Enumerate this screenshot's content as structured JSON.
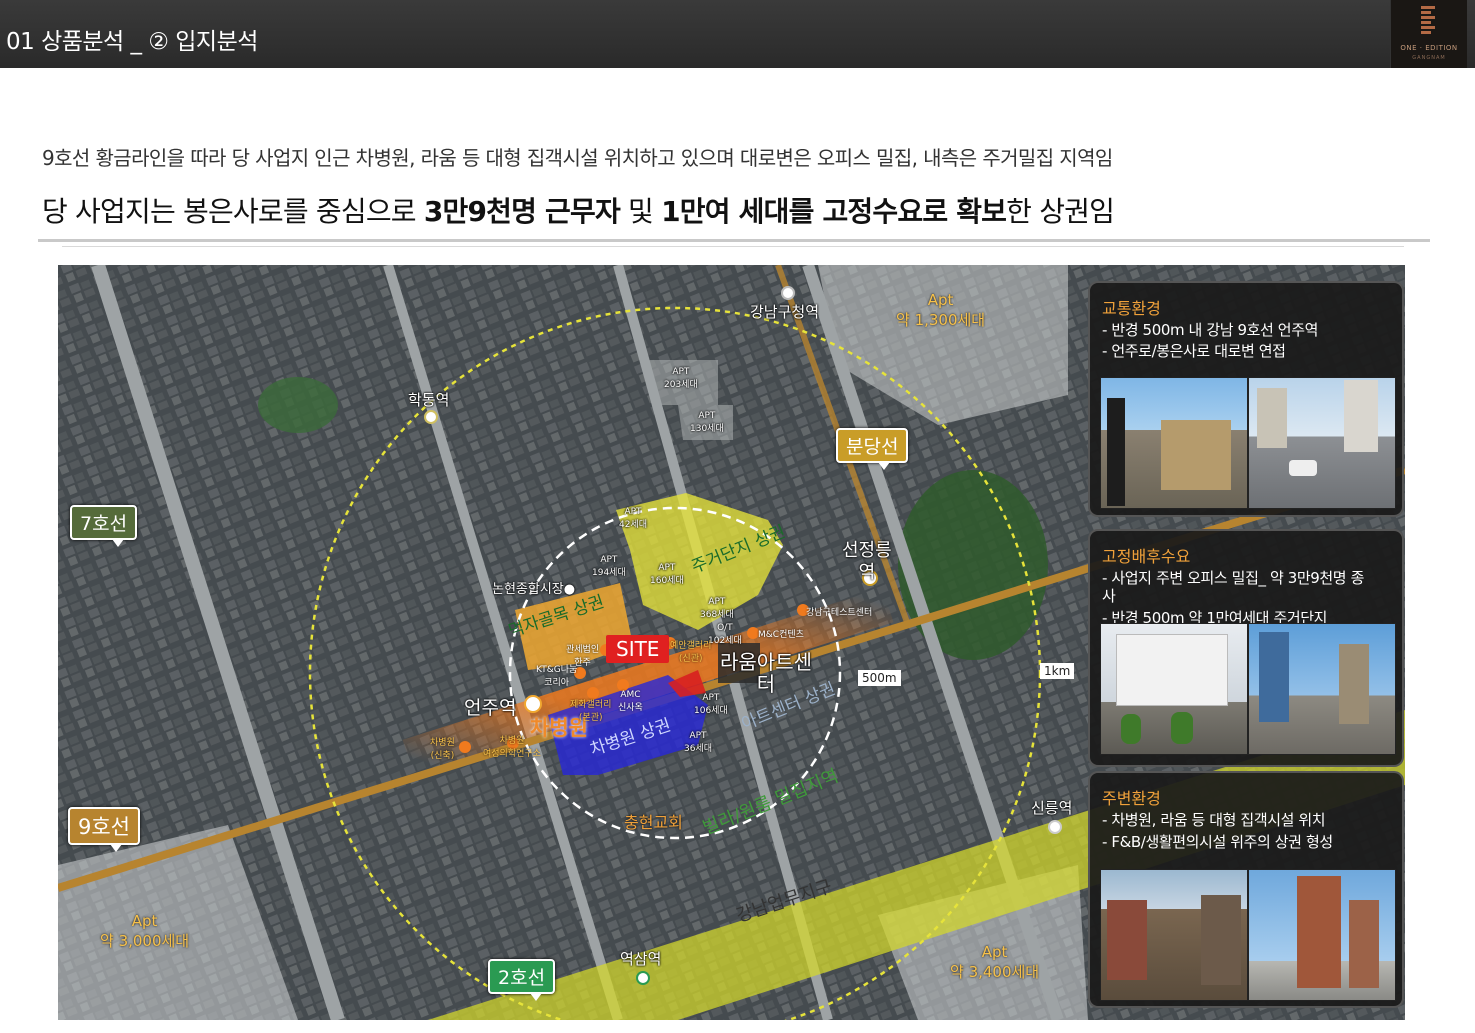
{
  "header": {
    "title": "01  상품분석 _  ② 입지분석"
  },
  "logo": {
    "name": "ONE · EDITION",
    "sub": "GANGNAM"
  },
  "description": {
    "line1": "9호선 황금라인을 따라 당 사업지 인근 차병원, 라움 등 대형 집객시설 위치하고 있으며 대로변은 오피스 밀집, 내측은 주거밀집 지역임",
    "line2_pre": "당 사업지는 봉은사로를 중심으로 ",
    "line2_b1": "3만9천명 근무자",
    "line2_mid": " 및 ",
    "line2_b2": "1만여 세대를 고정수요로 확보",
    "line2_post": "한 상권임"
  },
  "map": {
    "stations": {
      "gangnamgu": "강남구청역",
      "hakdong": "학동역",
      "seonjeongneung": "선정릉\n역",
      "eonju": "언주역",
      "sinnonhyeon": "신릉역",
      "yeoksam": "역삼역"
    },
    "lines": {
      "line7": "7호선",
      "line9": "9호선",
      "line2": "2호선",
      "bundang": "분당선"
    },
    "apt": [
      {
        "t": "Apt",
        "s": "약 1,300세대"
      },
      {
        "t": "Apt",
        "s": "약 3,000세대"
      },
      {
        "t": "Apt",
        "s": "약 3,400세대"
      }
    ],
    "apt_small": [
      {
        "t": "APT",
        "s": "203세대"
      },
      {
        "t": "APT",
        "s": "130세대"
      },
      {
        "t": "APT",
        "s": "42세대"
      },
      {
        "t": "APT",
        "s": "194세대"
      },
      {
        "t": "APT",
        "s": "160세대"
      },
      {
        "t": "APT",
        "s": "368세대"
      },
      {
        "t": "O/T",
        "s": "102세대"
      },
      {
        "t": "APT",
        "s": "106세대"
      },
      {
        "t": "APT",
        "s": "36세대"
      }
    ],
    "zones": {
      "residential": "주거단지 상권",
      "alley": "먹자골목 상권",
      "cha": "차병원 상권",
      "art": "아트센터 상권",
      "villa": "빌라/원룸 밀집지역",
      "business": "강남업무지구"
    },
    "places": {
      "site": "SITE",
      "chahospital": "차병원",
      "raum": "라움아트센\n터",
      "nonhyeon": "논현종합시장●",
      "chunghyeon": "충현교회",
      "kt": "KT&G나눔\n코리아",
      "gwanse": "관세법인\n한주",
      "yesan": "예안갤러리\n(신관)",
      "amc": "AMC\n신사옥",
      "mic": "M&C컨텐츠",
      "gangnamgu_office": "강남구테스트센터",
      "hosp1": "차병원\n(신축)",
      "hosp2": "차병원\n여성의학연구소",
      "jehwa": "제화갤러리\n(본관)"
    },
    "scale": {
      "r500": "500m",
      "r1k": "1km"
    }
  },
  "panels": [
    {
      "head": "교통환경",
      "lines": [
        "- 반경 500m 내 강남 9호선 언주역",
        "- 언주로/봉은사로 대로변 연접"
      ]
    },
    {
      "head": "고정배후수요",
      "lines": [
        "- 사업지 주변 오피스 밀집_ 약 3만9천명 종",
        "사",
        "- 반경 500m 약 1만여세대 주거단지"
      ]
    },
    {
      "head": "주변환경",
      "lines": [
        "- 차병원, 라움 등 대형 집객시설 위치",
        "- F&B/생활편의시설 위주의 상권 형성"
      ]
    }
  ],
  "colors": {
    "header_bg": "#2f2f2f",
    "accent_orange": "#f0a13a",
    "site_red": "#e02020",
    "zone_yellow": "#e6e33a",
    "zone_orange": "#f0a830",
    "zone_blue": "#3434e0",
    "line9": "#b7842f",
    "line7": "#556b3a",
    "line2": "#2a9a52",
    "bundang": "#c99d28"
  }
}
